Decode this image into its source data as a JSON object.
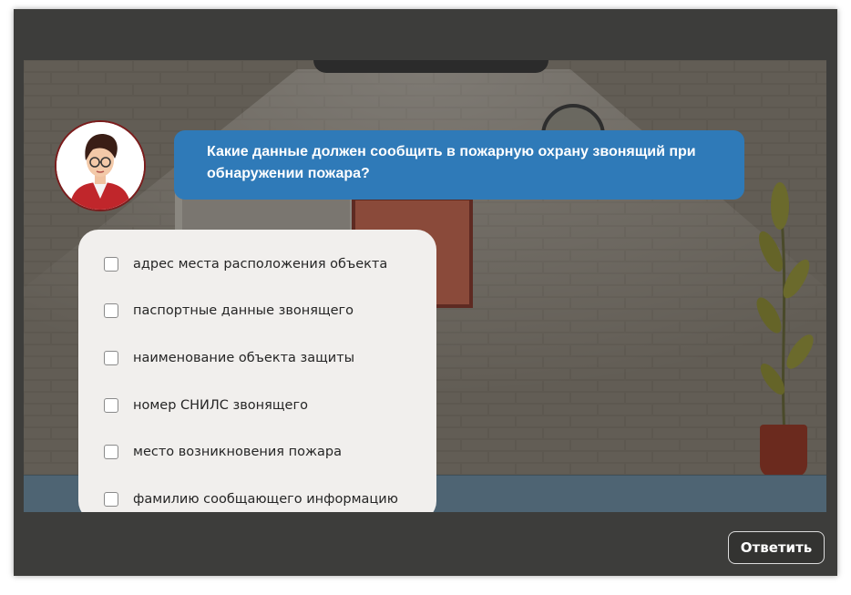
{
  "question": {
    "text": "Какие данные должен сообщить в пожарную охрану звонящий при обнаружении пожара?"
  },
  "options": [
    {
      "label": "адрес места расположения объекта",
      "checked": false
    },
    {
      "label": "паспортные данные звонящего",
      "checked": false
    },
    {
      "label": "наименование объекта защиты",
      "checked": false
    },
    {
      "label": "номер СНИЛС звонящего",
      "checked": false
    },
    {
      "label": "место возникновения пожара",
      "checked": false
    },
    {
      "label": "фамилию сообщающего информацию",
      "checked": false
    }
  ],
  "footer": {
    "submit_label": "Ответить"
  },
  "colors": {
    "bubble": "#2f7ab8",
    "player_frame": "#3d3d3b",
    "panel": "#f1efed"
  },
  "icons": {
    "avatar": "presenter-avatar-icon",
    "checkbox": "checkbox-icon"
  }
}
